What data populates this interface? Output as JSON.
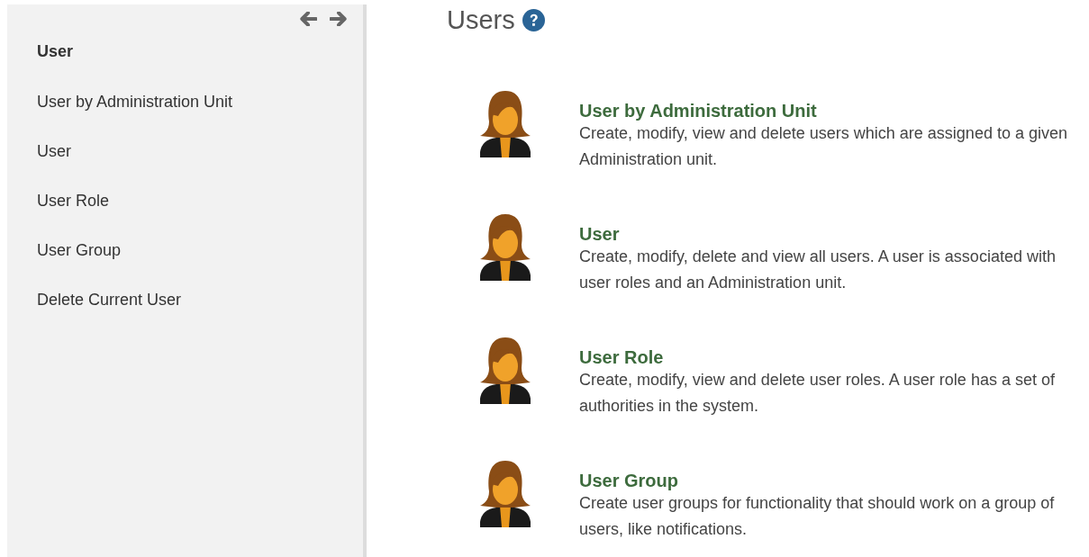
{
  "sidebar": {
    "nav_arrows": [
      {
        "kind": "back"
      },
      {
        "kind": "forward"
      }
    ],
    "heading": "User",
    "items": [
      {
        "label": "User by Administration Unit"
      },
      {
        "label": "User"
      },
      {
        "label": "User Role"
      },
      {
        "label": "User Group"
      },
      {
        "label": "Delete Current User"
      }
    ]
  },
  "main": {
    "title": "Users",
    "help": true,
    "entries": [
      {
        "title": "User by Administration Unit",
        "description": "Create, modify, view and delete users which are assigned to a given Administration unit."
      },
      {
        "title": "User",
        "description": "Create, modify, delete and view all users. A user is associated with user roles and an Administration unit."
      },
      {
        "title": "User Role",
        "description": "Create, modify, view and delete user roles. A user role has a set of authorities in the system."
      },
      {
        "title": "User Group",
        "description": "Create user groups for functionality that should work on a group of users, like notifications."
      }
    ]
  }
}
